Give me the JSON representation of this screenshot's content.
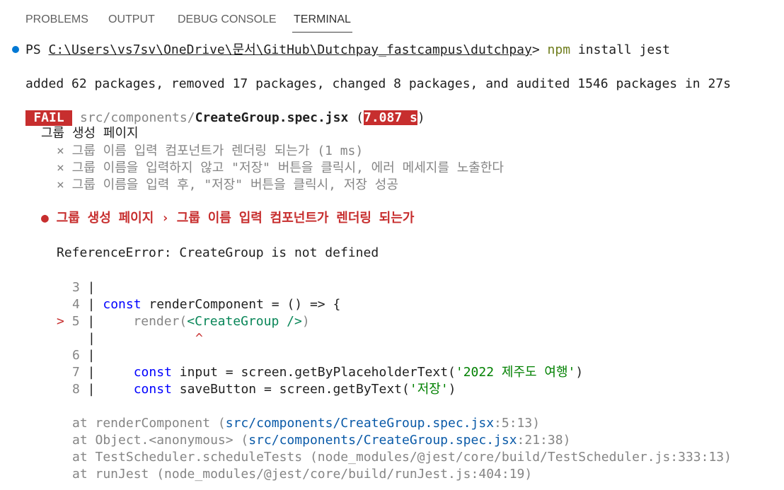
{
  "tabs": [
    {
      "label": "PROBLEMS"
    },
    {
      "label": "OUTPUT"
    },
    {
      "label": "DEBUG CONSOLE"
    },
    {
      "label": "TERMINAL"
    }
  ],
  "prompt": {
    "prefix": "PS ",
    "path": "C:\\Users\\vs7sv\\OneDrive\\문서\\GitHub\\Dutchpay_fastcampus\\dutchpay",
    "gt": "> ",
    "command": "npm",
    "args": " install jest"
  },
  "npm_result": "added 62 packages, removed 17 packages, changed 8 packages, and audited 1546 packages in 27s",
  "fail": {
    "badge": "FAIL",
    "dir": "src/components/",
    "file": "CreateGroup.spec.jsx",
    "paren_open": " (",
    "time": "7.087 s",
    "paren_close": ")"
  },
  "suite": {
    "name": "그룹 생성 페이지",
    "tests": [
      "× 그룹 이름 입력 컴포넌트가 렌더링 되는가 (1 ms)",
      "× 그룹 이름을 입력하지 않고 \"저장\" 버튼을 클릭시, 에러 메세지를 노출한다",
      "× 그룹 이름을 입력 후, \"저장\" 버튼을 클릭시, 저장 성공"
    ]
  },
  "error_title": "● 그룹 생성 페이지 › 그룹 이름 입력 컴포넌트가 렌더링 되는가",
  "error_message": "ReferenceError: CreateGroup is not defined",
  "code": {
    "l3": {
      "num": "3",
      "bar": " |"
    },
    "l4": {
      "num": "4",
      "bar": " | ",
      "kw": "const",
      "rest": " renderComponent = () => {"
    },
    "l5": {
      "marker": "> ",
      "num": "5",
      "bar": " |",
      "pre": "     render(",
      "tag": "<CreateGroup />",
      "post": ")"
    },
    "caret": {
      "bar": "|",
      "mark": "^"
    },
    "l6": {
      "num": "6",
      "bar": " |"
    },
    "l7": {
      "num": "7",
      "bar": " |",
      "indent": "     ",
      "kw": "const",
      "mid": " input = screen.getByPlaceholderText(",
      "str": "'2022 제주도 여행'",
      "end": ")"
    },
    "l8": {
      "num": "8",
      "bar": " |",
      "indent": "     ",
      "kw": "const",
      "mid": " saveButton = screen.getByText(",
      "str": "'저장'",
      "end": ")"
    }
  },
  "stack": [
    {
      "at": "at renderComponent (",
      "link": "src/components/CreateGroup.spec.jsx",
      "loc": ":5:13)"
    },
    {
      "at": "at Object.<anonymous> (",
      "link": "src/components/CreateGroup.spec.jsx",
      "loc": ":21:38)"
    },
    {
      "at": "at TestScheduler.scheduleTests (node_modules/@jest/core/build/TestScheduler.js:333:13)",
      "link": "",
      "loc": ""
    },
    {
      "at": "at runJest (node_modules/@jest/core/build/runJest.js:404:19)",
      "link": "",
      "loc": ""
    }
  ],
  "colors": {
    "fail_red": "#c72e2e",
    "prompt_dot": "#0078d4",
    "keyword": "#0000ff",
    "link": "#0a5aa8"
  }
}
